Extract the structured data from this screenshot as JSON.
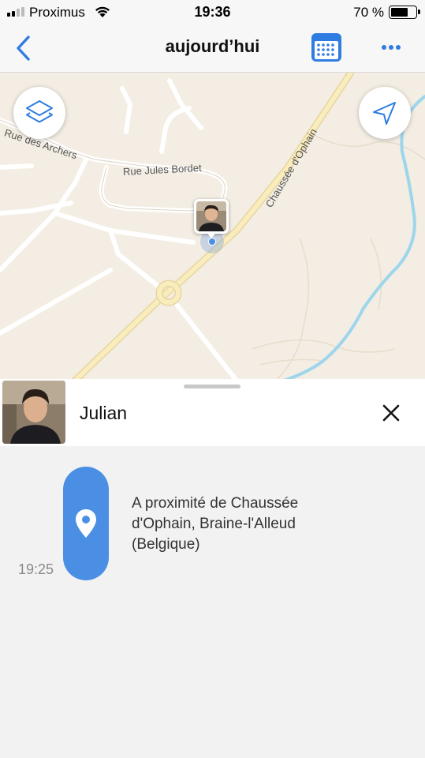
{
  "status_bar": {
    "carrier": "Proximus",
    "time": "19:36",
    "battery_percent": "70 %",
    "battery_level": 0.7
  },
  "nav": {
    "title": "aujourd’hui",
    "icons": {
      "back": "chevron-left-icon",
      "calendar": "calendar-icon",
      "more": "ellipsis-icon"
    }
  },
  "map": {
    "streets": {
      "archers": "Rue des Archers",
      "bordet": "Rue Jules Bordet",
      "ophain": "Chaussée d'Ophain"
    },
    "icons": {
      "layers": "layers-icon",
      "locate": "location-arrow-icon"
    }
  },
  "person": {
    "name": "Julian"
  },
  "timeline": {
    "entries": [
      {
        "time": "19:25",
        "address_lines": [
          "A proximité de Chaussée",
          "d'Ophain, Braine-l'Alleud",
          "(Belgique)"
        ],
        "icon": "map-pin-icon"
      }
    ]
  },
  "colors": {
    "accent": "#2f7de1",
    "pill": "#4a8fe3",
    "map_bg": "#f3ede3",
    "main_road": "#f6e7b0",
    "river": "#8fd0e8"
  }
}
